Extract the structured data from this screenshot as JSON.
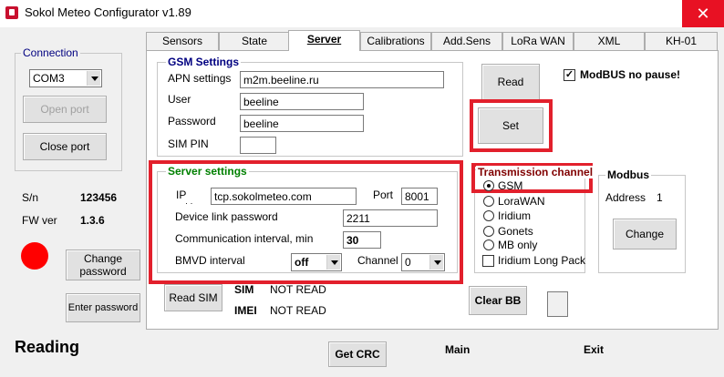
{
  "window": {
    "title": "Sokol Meteo Configurator v1.89",
    "close_glyph": "✕"
  },
  "connection": {
    "group_title": "Connection",
    "port_value": "COM3",
    "open_port": "Open port",
    "close_port": "Close port"
  },
  "device": {
    "sn_label": "S/n",
    "sn_value": "123456",
    "fw_label": "FW ver",
    "fw_value": "1.3.6",
    "status_color": "#ff0000"
  },
  "left_buttons": {
    "change_password": "Change password",
    "enter_password": "Enter password"
  },
  "tabs": [
    {
      "label": "Sensors"
    },
    {
      "label": "State"
    },
    {
      "label": "Server",
      "active": true
    },
    {
      "label": "Calibrations"
    },
    {
      "label": "Add.Sens"
    },
    {
      "label": "LoRa WAN"
    },
    {
      "label": "XML"
    },
    {
      "label": "KH-01"
    }
  ],
  "gsm": {
    "title": "GSM Settings",
    "apn_label": "APN settings",
    "apn_value": "m2m.beeline.ru",
    "user_label": "User",
    "user_value": "beeline",
    "password_label": "Password",
    "password_value": "beeline",
    "pin_label": "SIM PIN",
    "pin_value": ""
  },
  "server": {
    "title": "Server settings",
    "ip_label": "IP",
    "ip_sub": "· ·",
    "ip_value": "tcp.sokolmeteo.com",
    "port_label": "Port",
    "port_value": "8001",
    "link_password_label": "Device link password",
    "link_password_value": "2211",
    "interval_label": "Communication interval, min",
    "interval_value": "30",
    "bmvd_label": "BMVD interval",
    "bmvd_value": "off",
    "channel_label": "Channel",
    "channel_value": "0"
  },
  "actions": {
    "read": "Read",
    "set": "Set",
    "modbus_no_pause": "ModBUS no pause!",
    "modbus_checked": true,
    "clear_bb": "Clear BB",
    "read_sim": "Read SIM"
  },
  "transmission": {
    "title": "Transmission channel",
    "options": [
      {
        "label": "GSM",
        "checked": true
      },
      {
        "label": "LoraWAN",
        "checked": false
      },
      {
        "label": "Iridium",
        "checked": false
      },
      {
        "label": "Gonets",
        "checked": false
      },
      {
        "label": "MB only",
        "checked": false
      }
    ],
    "iridium_long_pack": "Iridium Long Pack"
  },
  "modbus": {
    "title": "Modbus",
    "address_label": "Address",
    "address_value": "1",
    "change": "Change"
  },
  "sim_info": {
    "sim_label": "SIM",
    "sim_value": "NOT READ",
    "imei_label": "IMEI",
    "imei_value": "NOT READ"
  },
  "footer": {
    "status": "Reading",
    "get_crc": "Get CRC",
    "main": "Main",
    "exit": "Exit"
  },
  "colors": {
    "highlight": "#e2202c",
    "group_green": "#008000",
    "group_darkred": "#800000",
    "group_navy": "#000080"
  }
}
